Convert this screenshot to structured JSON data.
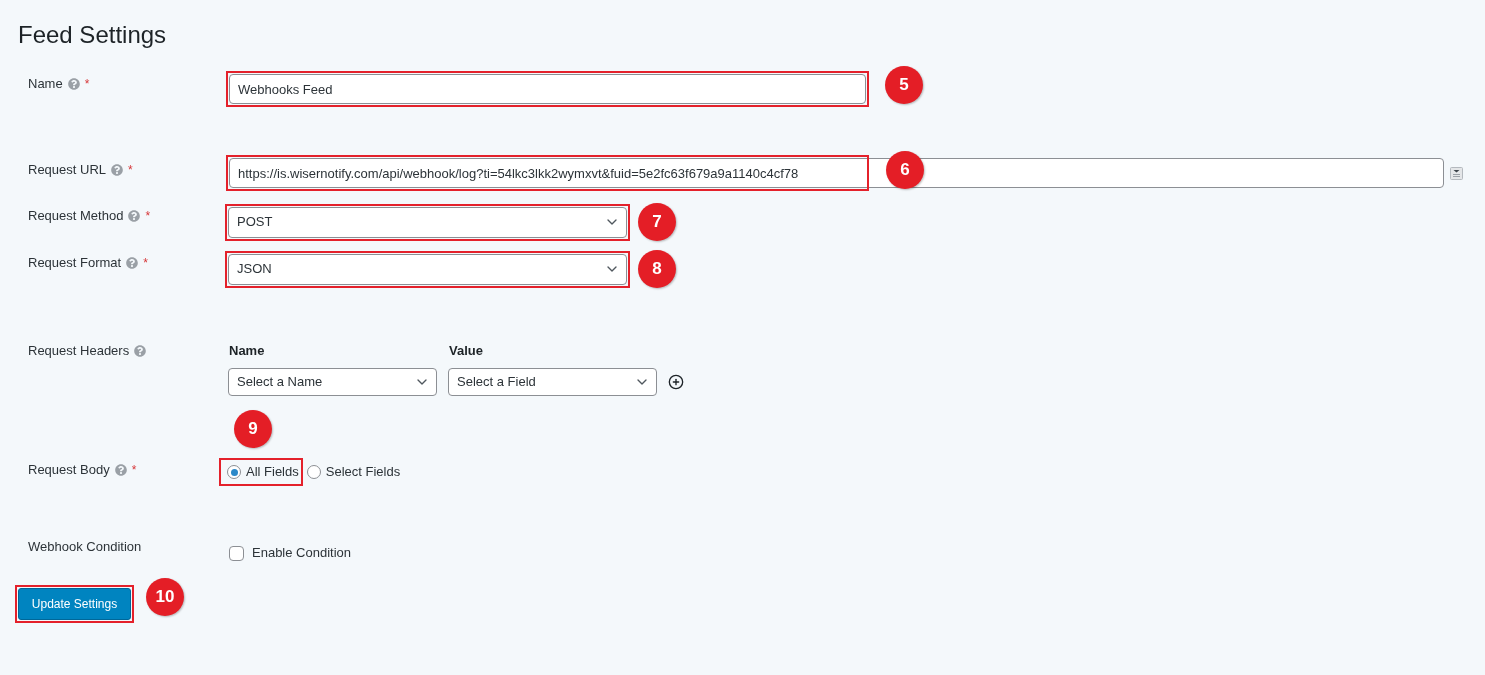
{
  "page": {
    "title": "Feed Settings"
  },
  "fields": [
    {
      "kind": "text",
      "label": "Name",
      "help": true,
      "required_mark": "*",
      "value": "Webhooks Feed",
      "highlighted": true,
      "callout": "5"
    },
    {
      "kind": "url",
      "label": "Request URL",
      "help": true,
      "required_mark": "*",
      "value": "https://is.wisernotify.com/api/webhook/log?ti=54lkc3lkk2wymxvt&fuid=5e2fc63f679a9a1140c4cf78",
      "highlighted": true,
      "callout": "6"
    },
    {
      "kind": "select",
      "label": "Request Method",
      "help": true,
      "required_mark": "*",
      "value": "POST",
      "highlighted": true,
      "callout": "7"
    },
    {
      "kind": "select",
      "label": "Request Format",
      "help": true,
      "required_mark": "*",
      "value": "JSON",
      "highlighted": true,
      "callout": "8"
    },
    {
      "kind": "headers",
      "label": "Request Headers",
      "help": true,
      "columns": [
        {
          "heading": "Name",
          "value": "Select a Name"
        },
        {
          "heading": "Value",
          "value": "Select a Field"
        }
      ]
    },
    {
      "kind": "radio",
      "label": "Request Body",
      "help": true,
      "required_mark": "*",
      "callout": "9",
      "options": [
        {
          "label": "All Fields",
          "selected": true,
          "highlighted": true
        },
        {
          "label": "Select Fields",
          "selected": false,
          "highlighted": false
        }
      ]
    },
    {
      "kind": "checkbox",
      "label": "Webhook Condition",
      "option": {
        "label": "Enable Condition",
        "checked": false
      }
    }
  ],
  "submit": {
    "label": "Update Settings",
    "highlighted": true,
    "callout": "10"
  }
}
